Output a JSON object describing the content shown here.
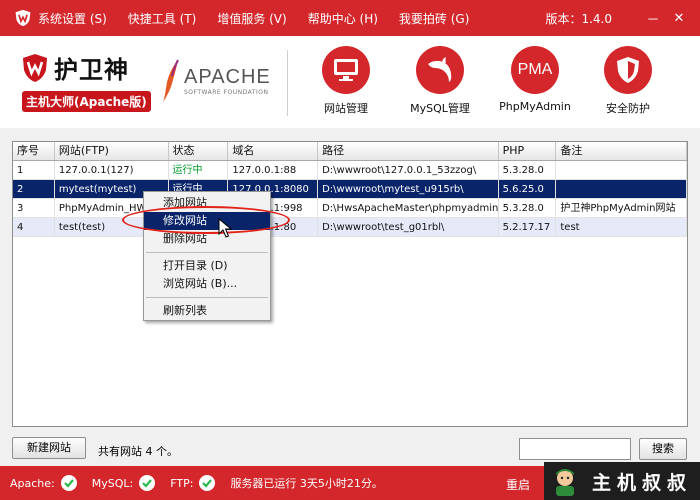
{
  "menu": {
    "items": [
      "系统设置 (S)",
      "快捷工具 (T)",
      "增值服务 (V)",
      "帮助中心 (H)",
      "我要拍砖 (G)"
    ],
    "version": "版本：1.4.0",
    "minimize": "－",
    "close": "✕"
  },
  "brand": {
    "name": "护卫神",
    "subtitle": "主机大师(Apache版)"
  },
  "apache_logo": {
    "name": "APACHE",
    "foundation": "SOFTWARE FOUNDATION"
  },
  "tools": [
    {
      "label": "网站管理",
      "icon": "monitor-icon"
    },
    {
      "label": "MySQL管理",
      "icon": "dolphin-icon"
    },
    {
      "label": "PhpMyAdmin",
      "icon": "pma-icon",
      "text": "PMA"
    },
    {
      "label": "安全防护",
      "icon": "shield-icon"
    }
  ],
  "table": {
    "columns": [
      "序号",
      "网站(FTP)",
      "状态",
      "域名",
      "路径",
      "PHP",
      "备注"
    ],
    "rows": [
      [
        "1",
        "127.0.0.1(127)",
        "运行中",
        "127.0.0.1:88",
        "D:\\wwwroot\\127.0.0.1_53zzog\\",
        "5.3.28.0",
        ""
      ],
      [
        "2",
        "mytest(mytest)",
        "运行中",
        "127.0.0.1:8080",
        "D:\\wwwroot\\mytest_u915rb\\",
        "5.6.25.0",
        ""
      ],
      [
        "3",
        "PhpMyAdmin_HWS",
        "",
        "127.0.0.1:998",
        "D:\\HwsApacheMaster\\phpmyadmin",
        "5.3.28.0",
        "护卫神PhpMyAdmin网站"
      ],
      [
        "4",
        "test(test)",
        "",
        "127.0.0.1:80",
        "D:\\wwwroot\\test_g01rbl\\",
        "5.2.17.17",
        "test"
      ]
    ],
    "selected_row": 1
  },
  "context_menu": {
    "items": [
      "添加网站",
      "修改网站",
      "删除网站",
      "打开目录 (D)",
      "浏览网站 (B)...",
      "刷新列表"
    ],
    "highlighted": "修改网站"
  },
  "bottom": {
    "new_site": "新建网站",
    "site_count": "共有网站 4 个。",
    "search_value": "",
    "search_button": "搜索"
  },
  "status": {
    "apache": "Apache:",
    "mysql": "MySQL:",
    "ftp": "FTP:",
    "uptime": "服务器已运行 3天5小时21分。",
    "restart": "重启"
  },
  "watermark": {
    "text": "主机叔叔"
  },
  "colors": {
    "brand_red": "#d4272c",
    "running_green": "#009a29",
    "selected_row": "#0a246a",
    "ok_green": "#2db84d"
  }
}
